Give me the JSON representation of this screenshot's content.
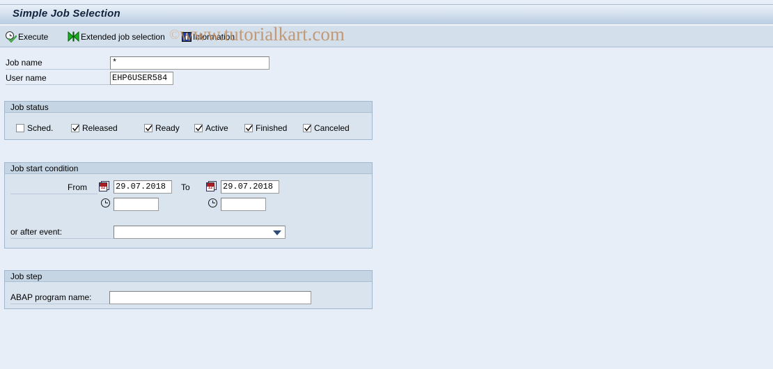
{
  "window": {
    "title": "Simple Job Selection"
  },
  "toolbar": {
    "execute_label": "Execute",
    "extended_label": "Extended job selection",
    "information_label": "Information",
    "icons": {
      "execute": "clock-check-icon",
      "extended": "bowtie-filter-icon",
      "information": "information-icon"
    }
  },
  "watermark": {
    "copyright": "©",
    "text": "www.tutorialkart.com",
    "color": "#c08a5a"
  },
  "form": {
    "job_name": {
      "label": "Job name",
      "value": "*",
      "placeholder": ""
    },
    "user_name": {
      "label": "User name",
      "value": "EHP6USER584",
      "placeholder": ""
    }
  },
  "job_status": {
    "title": "Job status",
    "items": [
      {
        "label": "Sched.",
        "checked": false
      },
      {
        "label": "Released",
        "checked": true
      },
      {
        "label": "Ready",
        "checked": true
      },
      {
        "label": "Active",
        "checked": true
      },
      {
        "label": "Finished",
        "checked": true
      },
      {
        "label": "Canceled",
        "checked": true
      }
    ]
  },
  "job_start_condition": {
    "title": "Job start condition",
    "from_label": "From",
    "to_label": "To",
    "from_date": "29.07.2018",
    "to_date": "29.07.2018",
    "from_time": "",
    "to_time": "",
    "calendar_day": "12",
    "event_label": "or after event:",
    "event_value": "",
    "event_options": []
  },
  "job_step": {
    "title": "Job step",
    "program_label": "ABAP program name:",
    "program_value": "",
    "program_placeholder": ""
  },
  "colors": {
    "page_background": "#e7eef7",
    "titlebar_gradient_top": "#e9f0f8",
    "titlebar_gradient_bottom": "#b9cce1",
    "toolbar_background": "#d3dfeb",
    "group_background": "#dae4ee",
    "group_header": "#c6d5e4",
    "accent_border": "#9fb6cc",
    "calendar_red": "#a81f24",
    "info_blue": "#1b3f9e",
    "bowtie_green": "#12a11a"
  }
}
